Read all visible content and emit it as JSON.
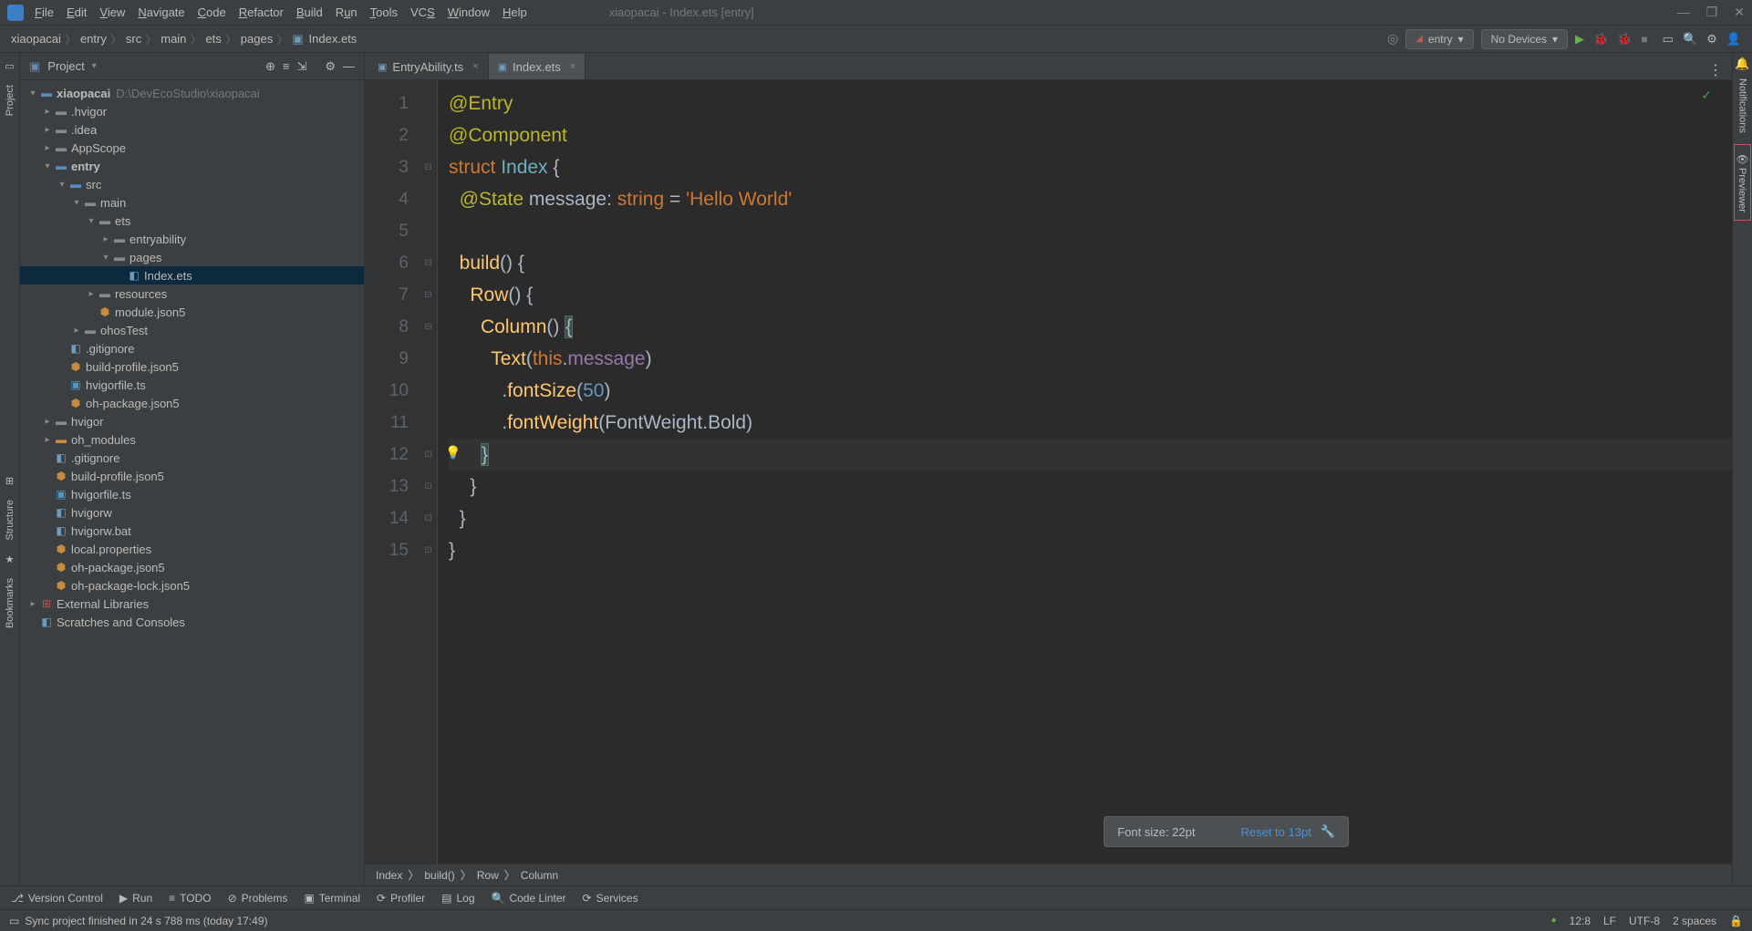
{
  "titlebar": {
    "menu": [
      "File",
      "Edit",
      "View",
      "Navigate",
      "Code",
      "Refactor",
      "Build",
      "Run",
      "Tools",
      "VCS",
      "Window",
      "Help"
    ],
    "title": "xiaopacai - Index.ets [entry]"
  },
  "toolbar": {
    "breadcrumb": [
      "xiaopacai",
      "entry",
      "src",
      "main",
      "ets",
      "pages",
      "Index.ets"
    ],
    "config": "entry",
    "devices": "No Devices"
  },
  "project_panel": {
    "title": "Project",
    "tree": [
      {
        "ind": 0,
        "arrow": "v",
        "icon": "folder-open",
        "label": "xiaopacai",
        "path": "D:\\DevEcoStudio\\xiaopacai",
        "bold": true
      },
      {
        "ind": 1,
        "arrow": ">",
        "icon": "folder",
        "label": ".hvigor"
      },
      {
        "ind": 1,
        "arrow": ">",
        "icon": "folder",
        "label": ".idea"
      },
      {
        "ind": 1,
        "arrow": ">",
        "icon": "folder",
        "label": "AppScope"
      },
      {
        "ind": 1,
        "arrow": "v",
        "icon": "folder-src",
        "label": "entry",
        "bold": true
      },
      {
        "ind": 2,
        "arrow": "v",
        "icon": "folder-src",
        "label": "src"
      },
      {
        "ind": 3,
        "arrow": "v",
        "icon": "folder",
        "label": "main"
      },
      {
        "ind": 4,
        "arrow": "v",
        "icon": "folder",
        "label": "ets"
      },
      {
        "ind": 5,
        "arrow": ">",
        "icon": "folder",
        "label": "entryability"
      },
      {
        "ind": 5,
        "arrow": "v",
        "icon": "folder",
        "label": "pages"
      },
      {
        "ind": 6,
        "arrow": "",
        "icon": "file",
        "label": "Index.ets",
        "selected": true
      },
      {
        "ind": 4,
        "arrow": ">",
        "icon": "folder",
        "label": "resources"
      },
      {
        "ind": 4,
        "arrow": "",
        "icon": "json",
        "label": "module.json5"
      },
      {
        "ind": 3,
        "arrow": ">",
        "icon": "folder",
        "label": "ohosTest"
      },
      {
        "ind": 2,
        "arrow": "",
        "icon": "file",
        "label": ".gitignore"
      },
      {
        "ind": 2,
        "arrow": "",
        "icon": "json",
        "label": "build-profile.json5"
      },
      {
        "ind": 2,
        "arrow": "",
        "icon": "ts",
        "label": "hvigorfile.ts"
      },
      {
        "ind": 2,
        "arrow": "",
        "icon": "json",
        "label": "oh-package.json5"
      },
      {
        "ind": 1,
        "arrow": ">",
        "icon": "folder",
        "label": "hvigor"
      },
      {
        "ind": 1,
        "arrow": ">",
        "icon": "folder-orange",
        "label": "oh_modules"
      },
      {
        "ind": 1,
        "arrow": "",
        "icon": "file",
        "label": ".gitignore"
      },
      {
        "ind": 1,
        "arrow": "",
        "icon": "json",
        "label": "build-profile.json5"
      },
      {
        "ind": 1,
        "arrow": "",
        "icon": "ts",
        "label": "hvigorfile.ts"
      },
      {
        "ind": 1,
        "arrow": "",
        "icon": "file",
        "label": "hvigorw"
      },
      {
        "ind": 1,
        "arrow": "",
        "icon": "file",
        "label": "hvigorw.bat"
      },
      {
        "ind": 1,
        "arrow": "",
        "icon": "json",
        "label": "local.properties"
      },
      {
        "ind": 1,
        "arrow": "",
        "icon": "json",
        "label": "oh-package.json5"
      },
      {
        "ind": 1,
        "arrow": "",
        "icon": "json",
        "label": "oh-package-lock.json5"
      },
      {
        "ind": 0,
        "arrow": ">",
        "icon": "ext",
        "label": "External Libraries"
      },
      {
        "ind": 0,
        "arrow": "",
        "icon": "file",
        "label": "Scratches and Consoles"
      }
    ]
  },
  "left_tabs": [
    "Project",
    "Structure",
    "Bookmarks"
  ],
  "right_tabs": [
    "Notifications",
    "Previewer"
  ],
  "editor": {
    "tabs": [
      {
        "label": "EntryAbility.ts",
        "active": false
      },
      {
        "label": "Index.ets",
        "active": true
      }
    ],
    "lines": [
      "1",
      "2",
      "3",
      "4",
      "5",
      "6",
      "7",
      "8",
      "9",
      "10",
      "11",
      "12",
      "13",
      "14",
      "15"
    ],
    "breadcrumb": [
      "Index",
      "build()",
      "Row",
      "Column"
    ]
  },
  "code": {
    "l1_entry": "@Entry",
    "l2_component": "@Component",
    "l3_struct": "struct",
    "l3_index": "Index",
    "l3_brace": "{",
    "l4_state": "@State",
    "l4_msg": "message",
    "l4_colon": ":",
    "l4_type": "string",
    "l4_eq": "=",
    "l4_str": "'Hello World'",
    "l6_build": "build",
    "l6_p": "()",
    "l6_b": "{",
    "l7_row": "Row",
    "l7_p": "()",
    "l7_b": "{",
    "l8_col": "Column",
    "l8_p": "()",
    "l8_b": "{",
    "l9_text": "Text",
    "l9_po": "(",
    "l9_this": "this",
    "l9_dot": ".",
    "l9_msg": "message",
    "l9_pc": ")",
    "l10_dot": ".",
    "l10_fs": "fontSize",
    "l10_po": "(",
    "l10_n": "50",
    "l10_pc": ")",
    "l11_dot": ".",
    "l11_fw": "fontWeight",
    "l11_po": "(",
    "l11_enum": "FontWeight",
    "l11_edot": ".",
    "l11_bold": "Bold",
    "l11_pc": ")",
    "l12": "}",
    "l13": "}",
    "l14": "}",
    "l15": "}"
  },
  "font_popup": {
    "label": "Font size: 22pt",
    "reset": "Reset to 13pt"
  },
  "bottom": [
    "Version Control",
    "Run",
    "TODO",
    "Problems",
    "Terminal",
    "Profiler",
    "Log",
    "Code Linter",
    "Services"
  ],
  "status": {
    "msg": "Sync project finished in 24 s 788 ms (today 17:49)",
    "pos": "12:8",
    "lf": "LF",
    "enc": "UTF-8",
    "indent": "2 spaces"
  }
}
